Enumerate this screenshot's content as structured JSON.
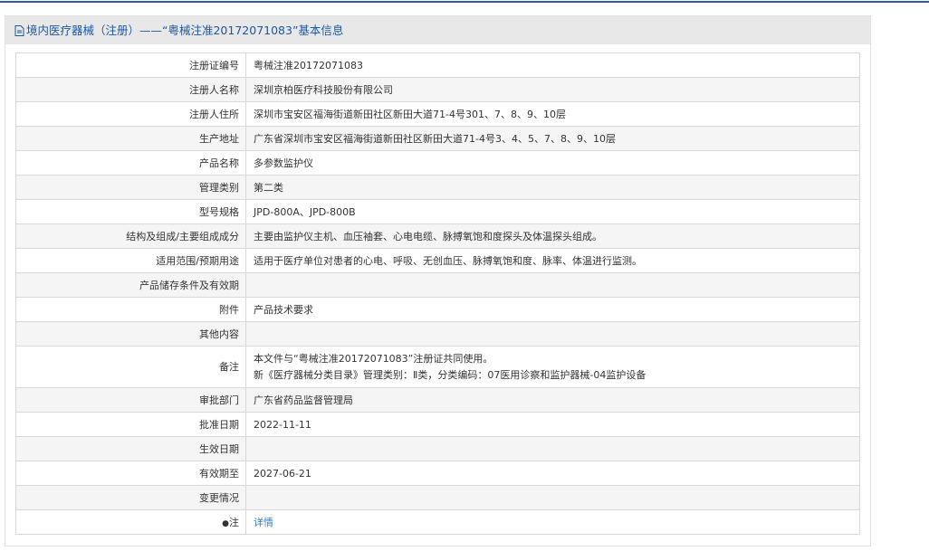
{
  "header": {
    "title": "境内医疗器械（注册）——“粤械注准20172071083”基本信息"
  },
  "rows": [
    {
      "label": "注册证编号",
      "value": "粤械注准20172071083"
    },
    {
      "label": "注册人名称",
      "value": "深圳京柏医疗科技股份有限公司"
    },
    {
      "label": "注册人住所",
      "value": "深圳市宝安区福海街道新田社区新田大道71-4号301、7、8、9、10层"
    },
    {
      "label": "生产地址",
      "value": "广东省深圳市宝安区福海街道新田社区新田大道71-4号3、4、5、7、8、9、10层"
    },
    {
      "label": "产品名称",
      "value": "多参数监护仪"
    },
    {
      "label": "管理类别",
      "value": "第二类"
    },
    {
      "label": "型号规格",
      "value": "JPD-800A、JPD-800B"
    },
    {
      "label": "结构及组成/主要组成成分",
      "value": "主要由监护仪主机、血压袖套、心电电缆、脉搏氧饱和度探头及体温探头组成。"
    },
    {
      "label": "适用范围/预期用途",
      "value": "适用于医疗单位对患者的心电、呼吸、无创血压、脉搏氧饱和度、脉率、体温进行监测。"
    },
    {
      "label": "产品储存条件及有效期",
      "value": ""
    },
    {
      "label": "附件",
      "value": "产品技术要求"
    },
    {
      "label": "其他内容",
      "value": ""
    },
    {
      "label": "备注",
      "value": "本文件与“粤械注准20172071083”注册证共同使用。",
      "value2": "新《医疗器械分类目录》管理类别：Ⅱ类，分类编码：07医用诊察和监护器械-04监护设备"
    },
    {
      "label": "审批部门",
      "value": "广东省药品监督管理局"
    },
    {
      "label": "批准日期",
      "value": "2022-11-11"
    },
    {
      "label": "生效日期",
      "value": ""
    },
    {
      "label": "有效期至",
      "value": "2027-06-21"
    },
    {
      "label": "变更情况",
      "value": ""
    },
    {
      "label": "注",
      "value": "详情"
    }
  ]
}
